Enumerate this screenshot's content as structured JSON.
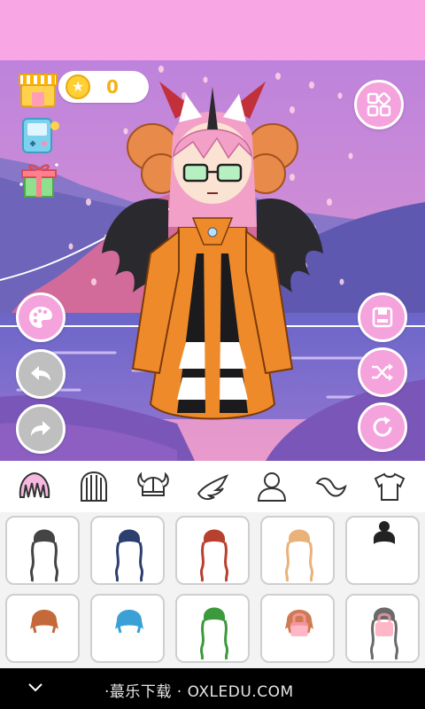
{
  "hud": {
    "coins": "0",
    "icons": {
      "shop": "shop-icon",
      "coin": "star-coin-icon",
      "minigame": "game-console-icon",
      "gift": "gift-icon",
      "menu": "grid-menu-icon"
    }
  },
  "side_buttons": {
    "left": [
      "palette-icon",
      "undo-icon",
      "redo-icon"
    ],
    "right": [
      "save-icon",
      "shuffle-icon",
      "reset-icon"
    ]
  },
  "tabs": [
    {
      "name": "bangs",
      "icon": "bangs-hair-icon",
      "selected": true
    },
    {
      "name": "back-hair",
      "icon": "back-hair-icon",
      "selected": false
    },
    {
      "name": "horns",
      "icon": "viking-horns-icon",
      "selected": false
    },
    {
      "name": "wings",
      "icon": "wing-icon",
      "selected": false
    },
    {
      "name": "body",
      "icon": "person-icon",
      "selected": false
    },
    {
      "name": "tail",
      "icon": "tail-icon",
      "selected": false
    },
    {
      "name": "clothes",
      "icon": "tshirt-icon",
      "selected": false
    }
  ],
  "items": [
    {
      "row": 1,
      "color": "#444444",
      "style": "long",
      "locked": false
    },
    {
      "row": 1,
      "color": "#2c3f6e",
      "style": "long",
      "locked": false
    },
    {
      "row": 1,
      "color": "#b8402e",
      "style": "long",
      "locked": false
    },
    {
      "row": 1,
      "color": "#e8b27a",
      "style": "long",
      "locked": false
    },
    {
      "row": 1,
      "color": "#222222",
      "style": "bun",
      "locked": false
    },
    {
      "row": 2,
      "color": "#c46a3a",
      "style": "short",
      "locked": false
    },
    {
      "row": 2,
      "color": "#3aa0d6",
      "style": "short",
      "locked": false
    },
    {
      "row": 2,
      "color": "#3c9a3c",
      "style": "long",
      "locked": false
    },
    {
      "row": 2,
      "color": "#cf7a52",
      "style": "short",
      "locked": true
    },
    {
      "row": 2,
      "color": "#6a6a6a",
      "style": "long",
      "locked": true
    }
  ],
  "colors": {
    "top_band": "#f9a6e5",
    "accent_pink": "#f5a3dc",
    "disabled_gray": "#bfbfbf",
    "coin_gold": "#f5b11c"
  },
  "watermark": "·蕞乐下载 · OXLEDU.COM"
}
